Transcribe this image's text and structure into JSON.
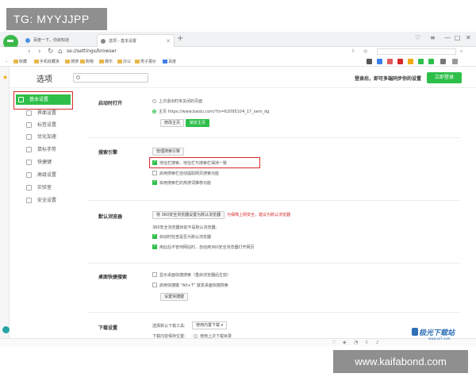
{
  "overlay": {
    "tg": "TG: MYYJJPP",
    "site": "www.kaifabond.com"
  },
  "tabs": [
    {
      "title": "百度一下，你就知道"
    },
    {
      "title": "选项 - 基本设置"
    }
  ],
  "address": {
    "url_prefix": "se://",
    "url_bold": "settings",
    "url_suffix": "/browser"
  },
  "bookmarks": [
    "收藏",
    "手机收藏夹",
    "搜搜",
    "购物",
    "娱乐",
    "办公",
    "男子报价",
    "百度"
  ],
  "header": {
    "title": "选项",
    "login_text": "登录后，即可多端同步你的设置",
    "login_button": "立即登录"
  },
  "nav": [
    "基本设置",
    "界面设置",
    "标签设置",
    "优化加速",
    "鼠标手势",
    "快捷键",
    "高级设置",
    "实验室",
    "安全设置"
  ],
  "startup": {
    "title": "启动时打开",
    "opt1": "上次退出时未关闭的页面",
    "opt2": "主页 https://www.baidu.com/?tn=62095104_17_oem_dg",
    "btn_edit": "修改主页",
    "btn_lock": "锁定主页"
  },
  "search": {
    "title": "搜索引擎",
    "btn_manage": "管理搜索引擎",
    "opt1": "地址栏搜索，地址栏与搜索栏保持一致",
    "opt2": "启用搜索栏自动提取网页搜索功能",
    "opt3": "启用搜索栏的热搜词推荐功能"
  },
  "default": {
    "title": "默认浏览器",
    "btn_set": "将 360安全浏览器设置为默认浏览器",
    "warning": "为保障上网安全，建议为默认浏览器",
    "status": "360安全浏览器目前不是默认浏览器。",
    "opt1": "启动时检查是否为默认浏览器",
    "opt2": "用此后不管何网站时，自动用360安全浏览器打开网页"
  },
  "desktop": {
    "title": "桌面快捷搜索",
    "opt1": "显示桌面快捷搜索（重启浏览器后生效）",
    "opt2": "启用快捷键 \"Alt+T\" 激发桌面快捷搜索",
    "btn_set": "设置快捷键"
  },
  "download": {
    "title": "下载设置",
    "label_tool": "选择默认下载工具:",
    "tool_value": "使用内置下载",
    "label_loc": "下载内容保存位置:",
    "loc_value": "使用上次下载目录"
  },
  "watermark": {
    "name": "极光下载站",
    "url": "www.xz7.com"
  },
  "colors": {
    "accent": "#2ebf4a",
    "highlight": "#d62b2b"
  }
}
